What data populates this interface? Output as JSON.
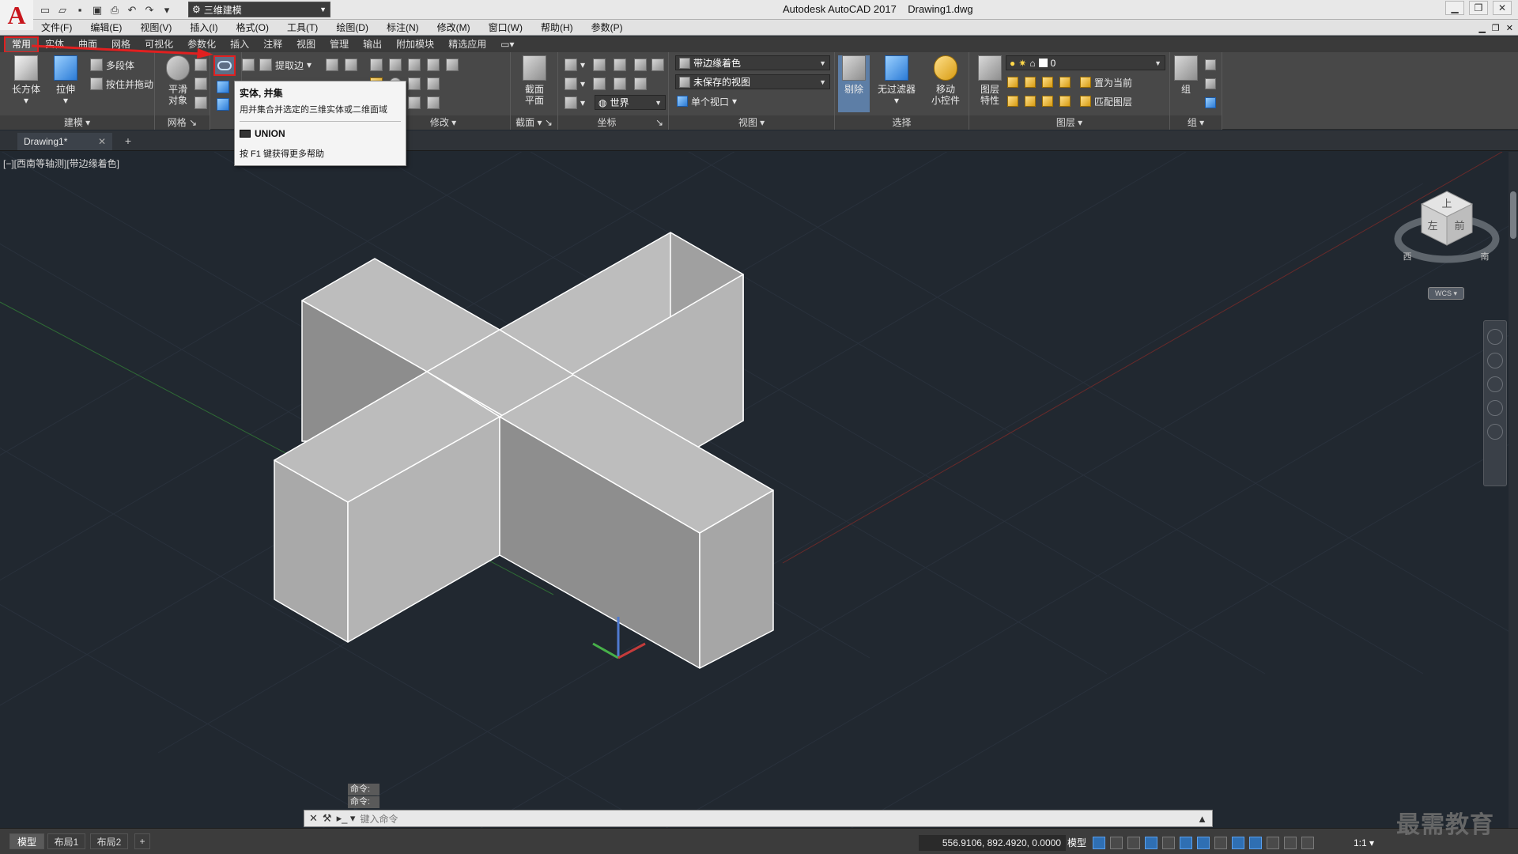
{
  "window": {
    "app_title": "Autodesk AutoCAD 2017",
    "file_title": "Drawing1.dwg",
    "workspace": "三维建模"
  },
  "menu": [
    "文件(F)",
    "编辑(E)",
    "视图(V)",
    "插入(I)",
    "格式(O)",
    "工具(T)",
    "绘图(D)",
    "标注(N)",
    "修改(M)",
    "窗口(W)",
    "帮助(H)",
    "参数(P)"
  ],
  "ribbon_tabs": [
    "常用",
    "实体",
    "曲面",
    "网格",
    "可视化",
    "参数化",
    "插入",
    "注释",
    "视图",
    "管理",
    "输出",
    "附加模块",
    "精选应用"
  ],
  "active_ribbon_tab": "常用",
  "panels": {
    "modeling": {
      "title": "建模",
      "box": "长方体",
      "extrude": "拉伸",
      "polysolid": "多段体",
      "presspull": "按住并拖动"
    },
    "mesh": {
      "title": "网格",
      "smooth": "平滑\n对象"
    },
    "modify": {
      "title": "修改",
      "extract_edges": "提取边"
    },
    "section": {
      "title": "截面",
      "section_plane": "截面\n平面"
    },
    "coordinates": {
      "title": "坐标",
      "ucs": "世界"
    },
    "view": {
      "title": "视图",
      "visual_style": "带边缘着色",
      "saved_view": "未保存的视图",
      "viewport": "单个视口"
    },
    "selection": {
      "title": "选择",
      "cull": "剔除",
      "no_filter": "无过滤器",
      "gizmo": "移动\n小控件"
    },
    "layers": {
      "title": "图层",
      "layer_props": "图层\n特性",
      "current_layer": "0",
      "set_current": "置为当前",
      "match_layer": "匹配图层"
    },
    "groups": {
      "title": "组",
      "group": "组"
    }
  },
  "tooltip": {
    "title": "实体, 并集",
    "description": "用并集合并选定的三维实体或二维面域",
    "command": "UNION",
    "help": "按 F1 键获得更多帮助"
  },
  "file_tabs": [
    {
      "label": "Drawing1*"
    }
  ],
  "viewport": {
    "label": "[−][西南等轴测][带边缘着色]",
    "viewcube": {
      "top": "上",
      "left": "左",
      "front": "前",
      "compass_w": "西",
      "compass_s": "南"
    },
    "wcs": "WCS"
  },
  "command": {
    "history": [
      "命令:",
      "命令:"
    ],
    "placeholder": "键入命令"
  },
  "layout_tabs": [
    "模型",
    "布局1",
    "布局2"
  ],
  "status": {
    "coords": "556.9106, 892.4920, 0.0000",
    "model": "模型",
    "scale": "1:1"
  },
  "watermark": "最需教育"
}
